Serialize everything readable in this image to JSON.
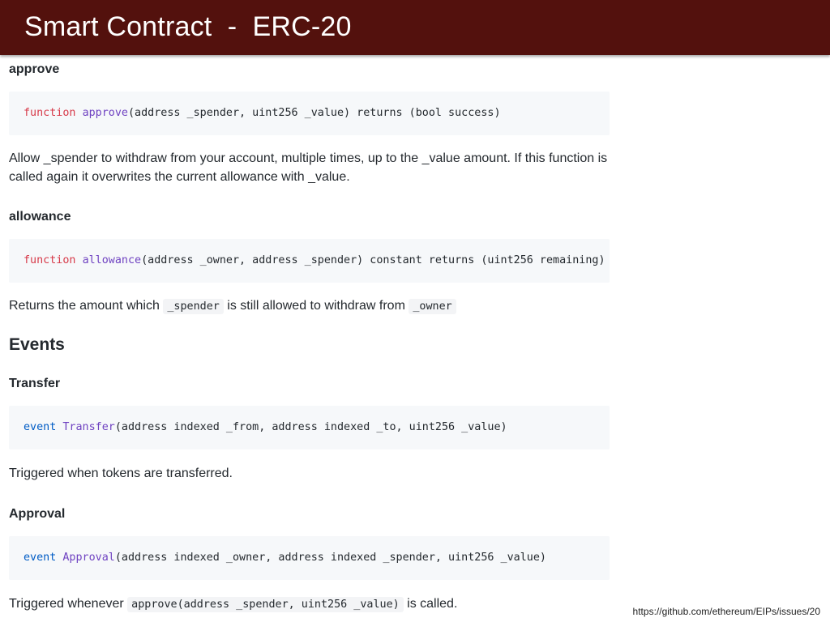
{
  "slide": {
    "title": "Smart Contract  -  ERC-20",
    "footer_url": "https://github.com/ethereum/EIPs/issues/20"
  },
  "approve": {
    "heading": "approve",
    "code": {
      "keyword": "function",
      "name": "approve",
      "rest": "(address _spender, uint256 _value) returns (bool success)"
    },
    "description": "Allow _spender to withdraw from your account, multiple times, up to the _value amount. If this function is called again it overwrites the current allowance with _value."
  },
  "allowance": {
    "heading": "allowance",
    "code": {
      "keyword": "function",
      "name": "allowance",
      "rest": "(address _owner, address _spender) constant returns (uint256 remaining)"
    },
    "description_part1": "Returns the amount which ",
    "inline_code1": "_spender",
    "description_part2": " is still allowed to withdraw from ",
    "inline_code2": "_owner"
  },
  "events": {
    "heading": "Events",
    "transfer": {
      "heading": "Transfer",
      "code": {
        "keyword": "event",
        "name": "Transfer",
        "rest": "(address indexed _from, address indexed _to, uint256 _value)"
      },
      "description": "Triggered when tokens are transferred."
    },
    "approval": {
      "heading": "Approval",
      "code": {
        "keyword": "event",
        "name": "Approval",
        "rest": "(address indexed _owner, address indexed _spender, uint256 _value)"
      },
      "description_part1": "Triggered whenever ",
      "inline_code": "approve(address _spender, uint256 _value)",
      "description_part2": " is called."
    }
  },
  "colors": {
    "title_bar": "#53110d",
    "code_background": "#f6f8fa",
    "keyword_function": "#d73a49",
    "keyword_event": "#005cc5",
    "function_name": "#6f42c1"
  }
}
